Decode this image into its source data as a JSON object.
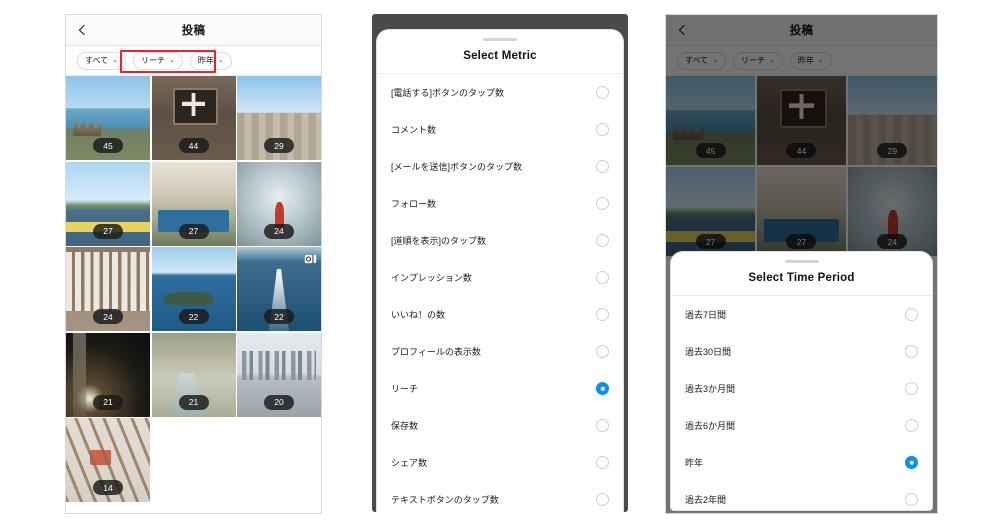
{
  "theme": {
    "accent_blue": "#0d8ff0",
    "highlight_red": "#e8232a",
    "badge_bg": "#1a1a1a",
    "page_bg": "#ffffff"
  },
  "left_panel": {
    "navbar": {
      "title": "投稿",
      "back_icon": "chevron-left-icon"
    },
    "filters": [
      {
        "label": "すべて",
        "chevron": "⌄",
        "highlighted": false
      },
      {
        "label": "リーチ",
        "chevron": "⌄",
        "highlighted": true
      },
      {
        "label": "昨年",
        "chevron": "⌄",
        "highlighted": true
      }
    ],
    "grid": [
      {
        "badge": "45",
        "art": "a-sea",
        "carousel": false
      },
      {
        "badge": "44",
        "art": "a-sign",
        "carousel": false
      },
      {
        "badge": "29",
        "art": "a-street",
        "carousel": false
      },
      {
        "badge": "27",
        "art": "a-mtn",
        "carousel": false
      },
      {
        "badge": "27",
        "art": "a-onsen",
        "carousel": false
      },
      {
        "badge": "24",
        "art": "a-corridor",
        "carousel": false
      },
      {
        "badge": "24",
        "art": "a-lanterns",
        "carousel": false
      },
      {
        "badge": "22",
        "art": "a-islands",
        "carousel": false
      },
      {
        "badge": "22",
        "art": "a-wake",
        "carousel": true
      },
      {
        "badge": "21",
        "art": "a-night",
        "carousel": false
      },
      {
        "badge": "21",
        "art": "a-river",
        "carousel": false
      },
      {
        "badge": "20",
        "art": "a-city",
        "carousel": false
      },
      {
        "badge": "14",
        "art": "a-roots",
        "carousel": false
      }
    ]
  },
  "middle_panel": {
    "sheet": {
      "title": "Select Metric",
      "grabber": "sheet-grabber",
      "options": [
        {
          "label": "[電話する]ボタンのタップ数",
          "selected": false
        },
        {
          "label": "コメント数",
          "selected": false
        },
        {
          "label": "[メールを送信]ボタンのタップ数",
          "selected": false
        },
        {
          "label": "フォロー数",
          "selected": false
        },
        {
          "label": "[道順を表示]のタップ数",
          "selected": false
        },
        {
          "label": "インプレッション数",
          "selected": false
        },
        {
          "label": "いいね！の数",
          "selected": false
        },
        {
          "label": "プロフィールの表示数",
          "selected": false
        },
        {
          "label": "リーチ",
          "selected": true
        },
        {
          "label": "保存数",
          "selected": false
        },
        {
          "label": "シェア数",
          "selected": false
        },
        {
          "label": "テキストボタンのタップ数",
          "selected": false
        }
      ]
    }
  },
  "right_panel": {
    "navbar": {
      "title": "投稿",
      "back_icon": "chevron-left-icon"
    },
    "filters": [
      {
        "label": "すべて",
        "chevron": "⌄"
      },
      {
        "label": "リーチ",
        "chevron": "⌄"
      },
      {
        "label": "昨年",
        "chevron": "⌄"
      }
    ],
    "grid": [
      {
        "badge": "45",
        "art": "a-sea"
      },
      {
        "badge": "44",
        "art": "a-sign"
      },
      {
        "badge": "29",
        "art": "a-street"
      },
      {
        "badge": "27",
        "art": "a-mtn"
      },
      {
        "badge": "27",
        "art": "a-onsen"
      },
      {
        "badge": "24",
        "art": "a-corridor"
      }
    ],
    "sheet": {
      "title": "Select Time Period",
      "grabber": "sheet-grabber",
      "options": [
        {
          "label": "過去7日間",
          "selected": false
        },
        {
          "label": "過去30日間",
          "selected": false
        },
        {
          "label": "過去3か月間",
          "selected": false
        },
        {
          "label": "過去6か月間",
          "selected": false
        },
        {
          "label": "昨年",
          "selected": true
        },
        {
          "label": "過去2年間",
          "selected": false
        }
      ]
    }
  }
}
